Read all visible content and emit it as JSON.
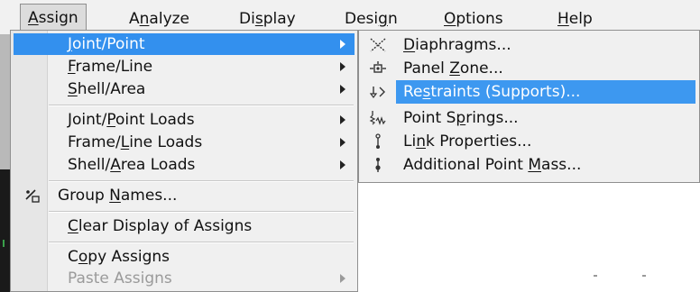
{
  "menubar": {
    "items": [
      {
        "label": "Assign",
        "mnemonic": "A",
        "rest": "ssign"
      },
      {
        "label": "Analyze",
        "pre": "A",
        "mnemonic": "n",
        "rest": "alyze"
      },
      {
        "label": "Display",
        "pre": "Di",
        "mnemonic": "s",
        "rest": "play"
      },
      {
        "label": "Design",
        "pre": "Desi",
        "mnemonic": "g",
        "rest": "n"
      },
      {
        "label": "Options",
        "mnemonic": "O",
        "rest": "ptions"
      },
      {
        "label": "Help",
        "mnemonic": "H",
        "rest": "elp"
      }
    ]
  },
  "assign_menu": {
    "items": [
      {
        "pre": "",
        "mnemonic": "J",
        "rest": "oint/Point"
      },
      {
        "pre": "",
        "mnemonic": "F",
        "rest": "rame/Line"
      },
      {
        "pre": "",
        "mnemonic": "S",
        "rest": "hell/Area"
      },
      {
        "pre": "Joint/",
        "mnemonic": "P",
        "rest": "oint Loads"
      },
      {
        "pre": "Frame/",
        "mnemonic": "L",
        "rest": "ine Loads"
      },
      {
        "pre": "Shell/",
        "mnemonic": "A",
        "rest": "rea Loads"
      },
      {
        "pre": "Group ",
        "mnemonic": "N",
        "rest": "ames..."
      },
      {
        "pre": "",
        "mnemonic": "C",
        "rest": "lear Display of Assigns"
      },
      {
        "pre": "C",
        "mnemonic": "o",
        "rest": "py Assigns"
      },
      {
        "pre": "Paste Assigns",
        "mnemonic": "",
        "rest": ""
      }
    ]
  },
  "joint_submenu": {
    "items": [
      {
        "icon": "diaphragm-icon",
        "pre": "",
        "mnemonic": "D",
        "rest": "iaphragms..."
      },
      {
        "icon": "panel-zone-icon",
        "pre": "Panel ",
        "mnemonic": "Z",
        "rest": "one..."
      },
      {
        "icon": "restraints-icon",
        "pre": "Re",
        "mnemonic": "s",
        "rest": "traints (Supports)..."
      },
      {
        "icon": "point-springs-icon",
        "pre": "Point S",
        "mnemonic": "p",
        "rest": "rings..."
      },
      {
        "icon": "link-properties-icon",
        "pre": "Li",
        "mnemonic": "n",
        "rest": "k Properties..."
      },
      {
        "icon": "point-mass-icon",
        "pre": "Additional Point ",
        "mnemonic": "M",
        "rest": "ass..."
      }
    ]
  },
  "colors": {
    "highlight": "#3390ee",
    "menu_bg": "#f0f0f0"
  }
}
